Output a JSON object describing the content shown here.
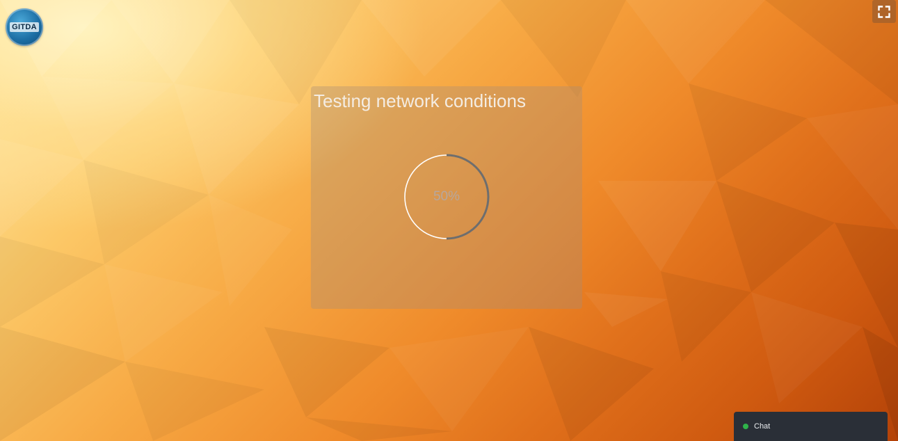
{
  "logo": {
    "text": "GITDA",
    "icon": "gitda-logo-icon"
  },
  "toolbar": {
    "fullscreen_icon": "fullscreen-icon"
  },
  "loader": {
    "title": "Testing network conditions",
    "progress_label": "50%",
    "progress_fraction": 0.5,
    "track_color": "#ffffff",
    "progress_color": "#6e6e6e"
  },
  "chat": {
    "label": "Chat",
    "status_color": "#2fb34a",
    "status_icon": "online-status-dot-icon"
  }
}
